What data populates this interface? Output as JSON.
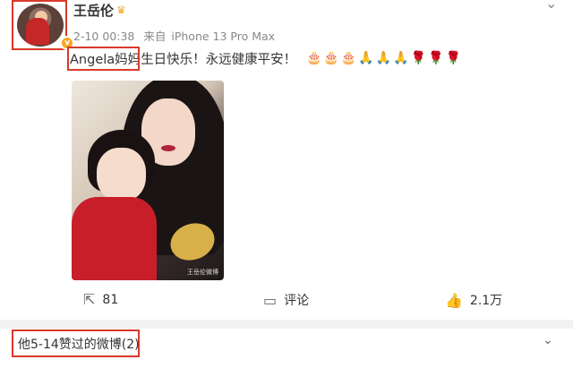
{
  "post": {
    "username": "王岳伦",
    "crown_icon": "crown-icon",
    "verified_badge": "v",
    "meta": {
      "time": "2-10 00:38",
      "source_prefix": "来自",
      "device": "iPhone 13 Pro Max"
    },
    "text": "Angela妈妈生日快乐！永远健康平安！",
    "emojis": "🎂🎂🎂🙏🙏🙏🌹🌹🌹",
    "photo_watermark": "王岳伦微博"
  },
  "actions": {
    "share_count": "81",
    "comment_label": "评论",
    "like_count": "2.1万"
  },
  "footer": {
    "label": "他5-14赞过的微博(2)"
  },
  "colors": {
    "highlight": "#d93a2b",
    "verified": "#f5a623"
  }
}
